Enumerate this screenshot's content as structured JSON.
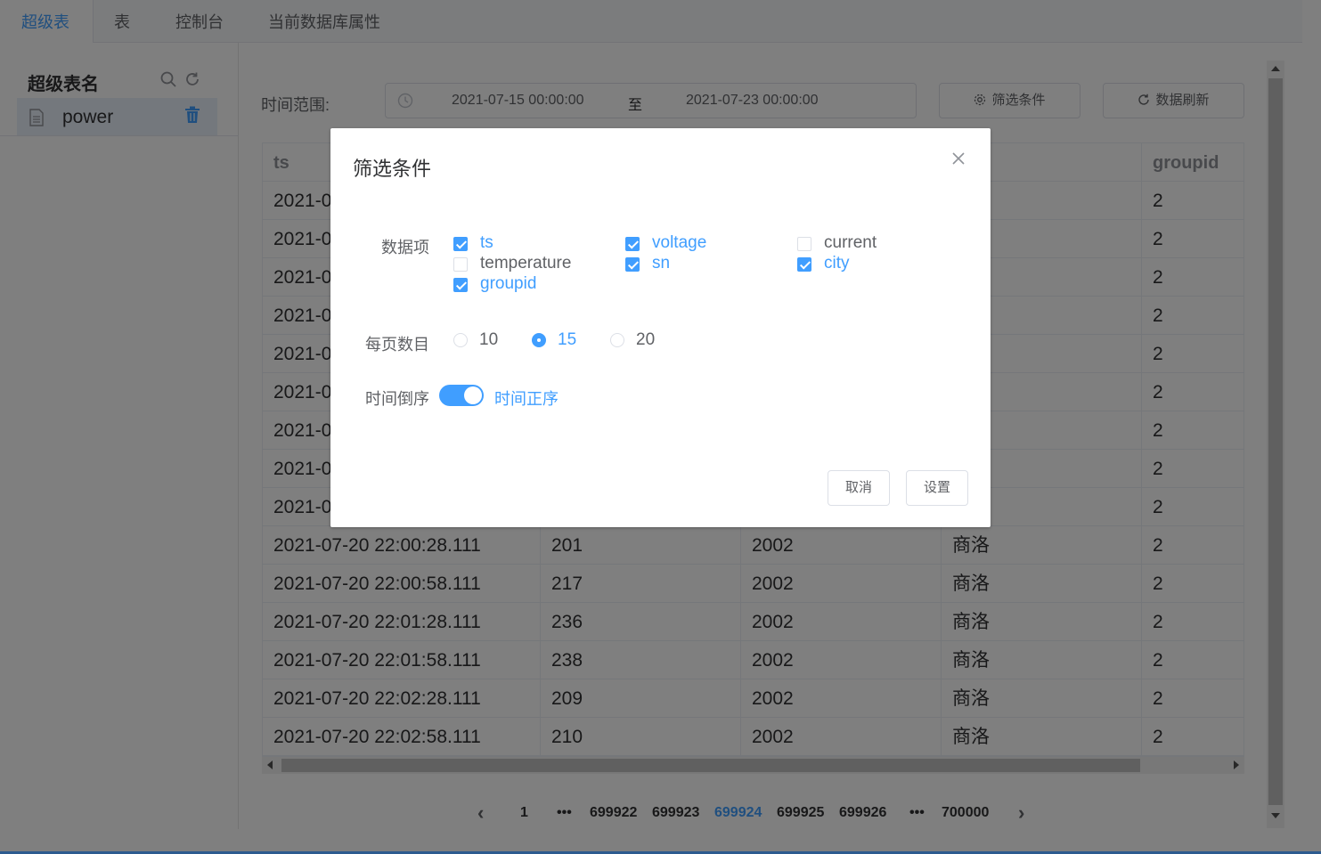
{
  "tabs": [
    "超级表",
    "表",
    "控制台",
    "当前数据库属性"
  ],
  "sidebar": {
    "title": "超级表名",
    "items": [
      {
        "name": "power"
      }
    ]
  },
  "toolbar": {
    "time_label": "时间范围:",
    "start": "2021-07-15 00:00:00",
    "separator": "至",
    "end": "2021-07-23 00:00:00",
    "filter_button": "筛选条件",
    "refresh_button": "数据刷新"
  },
  "table": {
    "columns": [
      "ts",
      "",
      "",
      "",
      "groupid"
    ],
    "rows": [
      [
        "2021-0",
        "",
        "",
        "",
        "2"
      ],
      [
        "2021-0",
        "",
        "",
        "",
        "2"
      ],
      [
        "2021-0",
        "",
        "",
        "",
        "2"
      ],
      [
        "2021-0",
        "",
        "",
        "",
        "2"
      ],
      [
        "2021-0",
        "",
        "",
        "",
        "2"
      ],
      [
        "2021-0",
        "",
        "",
        "",
        "2"
      ],
      [
        "2021-0",
        "",
        "",
        "",
        "2"
      ],
      [
        "2021-0",
        "",
        "",
        "",
        "2"
      ],
      [
        "2021-0",
        "",
        "",
        "",
        "2"
      ],
      [
        "2021-07-20 22:00:28.111",
        "201",
        "2002",
        "商洛",
        "2"
      ],
      [
        "2021-07-20 22:00:58.111",
        "217",
        "2002",
        "商洛",
        "2"
      ],
      [
        "2021-07-20 22:01:28.111",
        "236",
        "2002",
        "商洛",
        "2"
      ],
      [
        "2021-07-20 22:01:58.111",
        "238",
        "2002",
        "商洛",
        "2"
      ],
      [
        "2021-07-20 22:02:28.111",
        "209",
        "2002",
        "商洛",
        "2"
      ],
      [
        "2021-07-20 22:02:58.111",
        "210",
        "2002",
        "商洛",
        "2"
      ]
    ]
  },
  "pagination": {
    "prev": "‹",
    "pages": [
      "1",
      "•••",
      "699922",
      "699923",
      "699924",
      "699925",
      "699926",
      "•••",
      "700000"
    ],
    "current": "699924",
    "next": "›"
  },
  "dialog": {
    "title": "筛选条件",
    "fields_label": "数据项",
    "fields": [
      {
        "label": "ts",
        "checked": true
      },
      {
        "label": "voltage",
        "checked": true
      },
      {
        "label": "current",
        "checked": false
      },
      {
        "label": "temperature",
        "checked": false
      },
      {
        "label": "sn",
        "checked": true
      },
      {
        "label": "city",
        "checked": true
      },
      {
        "label": "groupid",
        "checked": true
      }
    ],
    "page_size_label": "每页数目",
    "page_sizes": [
      "10",
      "15",
      "20"
    ],
    "page_size_selected": "15",
    "order_label": "时间倒序",
    "order_on_label": "时间正序",
    "order_switch_on": true,
    "cancel": "取消",
    "confirm": "设置"
  },
  "colors": {
    "accent": "#409eff",
    "overlay": "rgba(0,0,0,0.5)"
  }
}
